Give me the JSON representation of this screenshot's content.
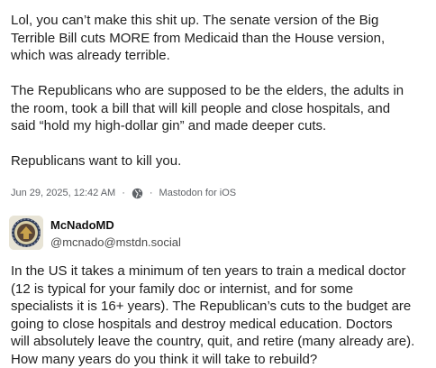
{
  "post1": {
    "paragraphs": [
      "Lol, you can’t make this shit up. The senate version of the Big\nTerrible Bill cuts MORE from Medicaid than the House version,\nwhich was already terrible.",
      "The Republicans who are supposed to be the elders, the adults in\nthe room, took a bill that will kill people and close hospitals, and\nsaid “hold my high-dollar gin” and made deeper cuts.",
      "Republicans want to kill you."
    ],
    "timestamp": "Jun 29, 2025, 12:42 AM",
    "separator": "·",
    "visibility_icon": "globe-icon",
    "client": "Mastodon for iOS"
  },
  "post2": {
    "display_name": "McNadoMD",
    "handle": "@mcnado@mstdn.social",
    "avatar_icon": "avatar-seal-icon",
    "body": "In the US it takes a minimum of ten years to train a medical doctor\n(12 is typical for your family doc or internist, and for some\nspecialists it is 16+ years). The Republican’s cuts to the budget are\ngoing to close hospitals and destroy medical education. Doctors\nwill absolutely leave the country, quit, and retire (many already are).\nHow many years do you think it will take to rebuild?"
  },
  "colors": {
    "text": "#1f1f1f",
    "meta_text": "#606368",
    "background": "#ffffff"
  }
}
